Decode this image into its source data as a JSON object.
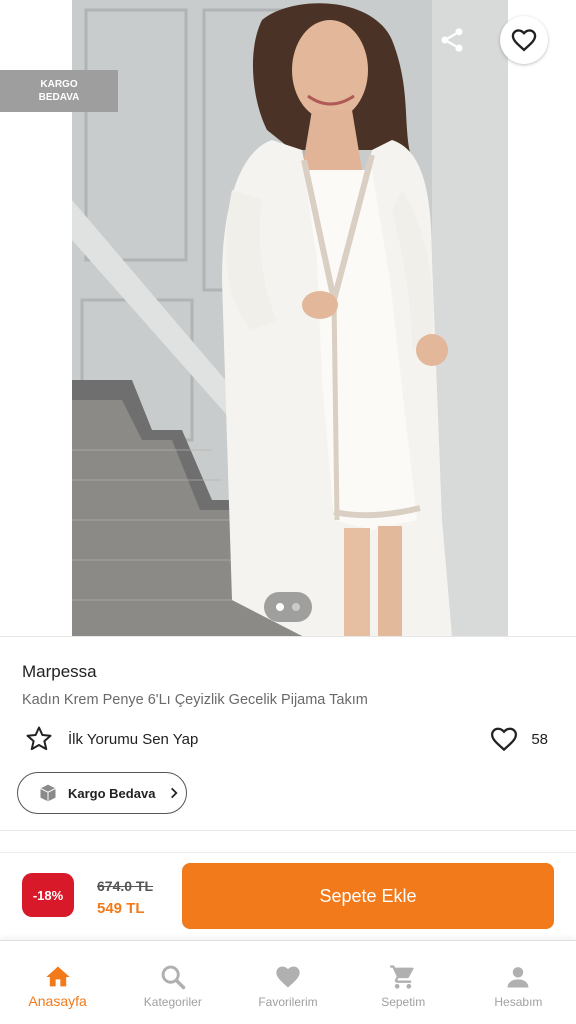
{
  "header": {
    "back_icon": "arrow-left-icon",
    "share_icon": "share-icon",
    "favorite_icon": "heart-outline-icon",
    "cargo_tag": "KARGO BEDAVA"
  },
  "gallery": {
    "image_count": 2,
    "active_index": 0
  },
  "product": {
    "brand": "Marpessa",
    "title": "Kadın Krem Penye 6'Lı Çeyizlik Gecelik Pijama Takım",
    "review_cta": "İlk Yorumu Sen Yap",
    "like_count": "58",
    "cargo_chip": "Kargo Bedava"
  },
  "purchase": {
    "discount": "-18%",
    "old_price": "674.0 TL",
    "new_price": "549 TL",
    "add_to_cart": "Sepete Ekle"
  },
  "tabbar": {
    "items": [
      {
        "label": "Anasayfa",
        "icon": "home-icon",
        "active": true
      },
      {
        "label": "Kategoriler",
        "icon": "search-icon",
        "active": false
      },
      {
        "label": "Favorilerim",
        "icon": "heart-icon",
        "active": false
      },
      {
        "label": "Sepetim",
        "icon": "cart-icon",
        "active": false
      },
      {
        "label": "Hesabım",
        "icon": "user-icon",
        "active": false
      }
    ]
  },
  "colors": {
    "accent": "#f27a1a",
    "discount": "#d7192a",
    "tag_gray": "#9e9e9e"
  }
}
